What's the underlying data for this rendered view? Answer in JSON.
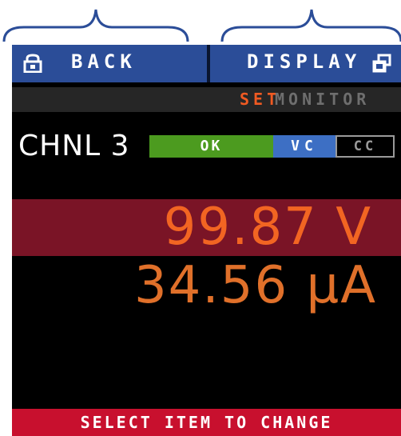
{
  "header": {
    "back_label": "BACK",
    "display_label": "DISPLAY"
  },
  "tabs": {
    "set_label": "SET",
    "monitor_label": "MONITOR",
    "active": "SET"
  },
  "channel": {
    "label": "CHNL 3",
    "status_ok": "OK",
    "mode_vc": "VC",
    "mode_cc": "CC",
    "active_mode": "VC"
  },
  "readings": {
    "voltage": "99.87 V",
    "current": "34.56 µA"
  },
  "footer": {
    "hint": "SELECT ITEM TO CHANGE"
  },
  "icons": {
    "back": "lock-icon",
    "display": "windows-icon"
  },
  "colors": {
    "header_bg": "#2b4d98",
    "set_accent": "#f05a22",
    "ok_green": "#4c9b1f",
    "vc_blue": "#3d6fc4",
    "voltage_row_bg": "#7a1426",
    "value_orange": "#f26522",
    "hint_red": "#c8102e"
  }
}
